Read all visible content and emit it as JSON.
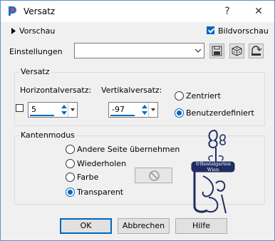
{
  "window": {
    "title": "Versatz",
    "help_glyph": "?",
    "close_glyph": "✕"
  },
  "top": {
    "preview_label": "Vorschau",
    "image_preview_label": "Bildvorschau",
    "image_preview_checked": true,
    "settings_label": "Einstellungen",
    "settings_value": ""
  },
  "offset_group": {
    "title": "Versatz",
    "horizontal_label": "Horizontalversatz:",
    "horizontal_value": "5",
    "vertical_label": "Vertikalversatz:",
    "vertical_value": "-97",
    "centered_label": "Zentriert",
    "custom_label": "Benutzerdefiniert",
    "selected": "custom"
  },
  "edge_group": {
    "title": "Kantenmodus",
    "options": [
      "Andere Seite übernehmen",
      "Wiederholen",
      "Farbe",
      "Transparent"
    ],
    "selected": "Transparent"
  },
  "watermark": {
    "line1": "©Rentalgarten",
    "line2": "Wien"
  },
  "buttons": {
    "ok": "OK",
    "cancel": "Abbrechen",
    "help": "Hilfe"
  },
  "colors": {
    "accent": "#0067c0",
    "window_bg": "#f0f0f0"
  }
}
